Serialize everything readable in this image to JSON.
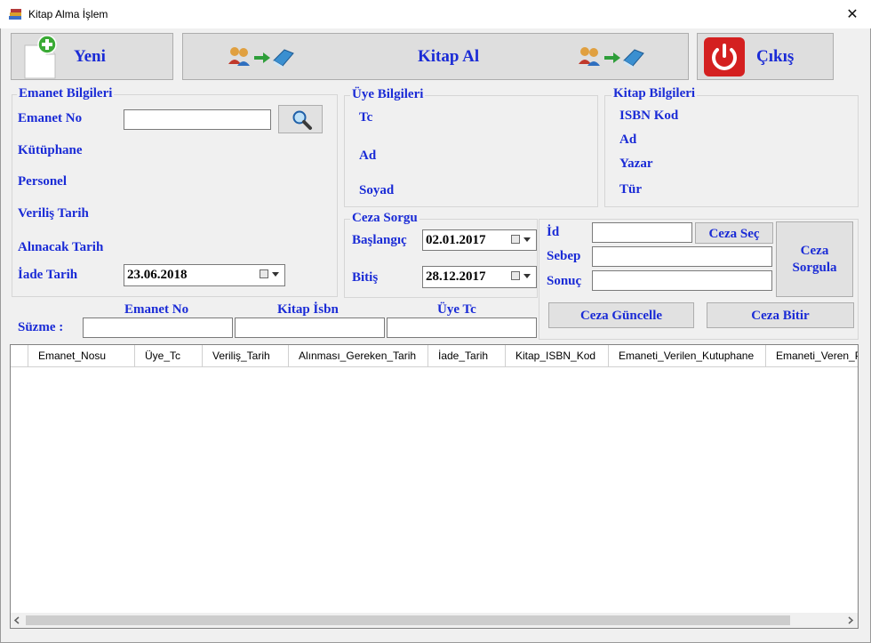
{
  "window": {
    "title": "Kitap Alma İşlem",
    "close_glyph": "✕"
  },
  "toolbar": {
    "yeni_label": "Yeni",
    "kitap_al_label": "Kitap Al",
    "cikis_label": "Çıkış"
  },
  "emanet": {
    "group_title": "Emanet Bilgileri",
    "emanet_no_label": "Emanet No",
    "emanet_no_value": "",
    "kutuphane_label": "Kütüphane",
    "personel_label": "Personel",
    "verilis_label": "Veriliş Tarih",
    "alinacak_label": "Alınacak Tarih",
    "iade_label": "İade Tarih",
    "iade_value": "23.06.2018"
  },
  "uye": {
    "group_title": "Üye Bilgileri",
    "tc_label": "Tc",
    "ad_label": "Ad",
    "soyad_label": "Soyad"
  },
  "kitap": {
    "group_title": "Kitap Bilgileri",
    "isbn_label": "ISBN Kod",
    "ad_label": "Ad",
    "yazar_label": "Yazar",
    "tur_label": "Tür"
  },
  "ceza_sorgu": {
    "group_title": "Ceza Sorgu",
    "baslangic_label": "Başlangıç",
    "baslangic_value": "02.01.2017",
    "bitis_label": "Bitiş",
    "bitis_value": "28.12.2017"
  },
  "ceza": {
    "id_label": "İd",
    "sebep_label": "Sebep",
    "sonuc_label": "Sonuç",
    "ceza_sec_label": "Ceza Seç",
    "ceza_sorgula_line1": "Ceza",
    "ceza_sorgula_line2": "Sorgula",
    "ceza_guncelle_label": "Ceza Güncelle",
    "ceza_bitir_label": "Ceza Bitir"
  },
  "filter": {
    "suzme_label": "Süzme :",
    "emanet_no_label": "Emanet No",
    "kitap_isbn_label": "Kitap İsbn",
    "uye_tc_label": "Üye Tc"
  },
  "grid": {
    "columns": [
      "Emanet_Nosu",
      "Üye_Tc",
      "Veriliş_Tarih",
      "Alınması_Gereken_Tarih",
      "İade_Tarih",
      "Kitap_ISBN_Kod",
      "Emaneti_Verilen_Kutuphane",
      "Emaneti_Veren_Pe"
    ],
    "rows": []
  },
  "colors": {
    "accent": "#1a2bd6",
    "window_bg": "#f0f0f0",
    "plus_green": "#3aaa35",
    "power_red": "#d42020"
  },
  "icons": {
    "app": "books-icon",
    "new": "new-document-plus-icon",
    "transfer": "users-arrow-book-icon",
    "search": "magnifier-icon",
    "exit": "power-icon",
    "calendar": "calendar-dropdown-icon"
  }
}
